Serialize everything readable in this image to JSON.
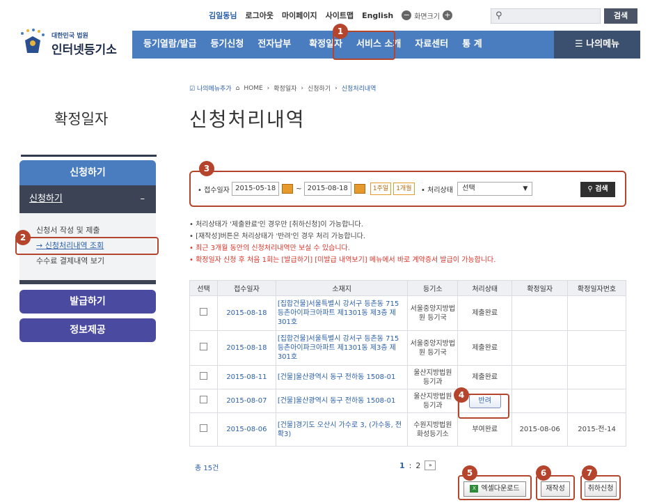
{
  "util": {
    "user": "김일동님",
    "logout": "로그아웃",
    "mypage": "마이페이지",
    "sitemap": "사이트맵",
    "english": "English",
    "screen_size": "화면크기",
    "search_button": "검색"
  },
  "logo": {
    "small": "대한민국 법원",
    "big": "인터넷등기소"
  },
  "nav": {
    "items": [
      "등기열람/발급",
      "등기신청",
      "전자납부",
      "확정일자",
      "서비스 소개",
      "자료센터",
      "통 계"
    ],
    "mymenu": "나의메뉴"
  },
  "breadcrumb": {
    "add": "나의메뉴추가",
    "home": "HOME",
    "path1": "확정일자",
    "path2": "신청하기",
    "current": "신청처리내역"
  },
  "side": {
    "title": "확정일자",
    "head": "신청하기",
    "sub": "신청하기",
    "sub_toggle": "–",
    "links": [
      "신청서 작성 및 제출",
      "신청처리내역 조회",
      "수수료 결제내역 보기"
    ],
    "btn1": "발급하기",
    "btn2": "정보제공"
  },
  "page_title": "신청처리내역",
  "filter": {
    "date_label": "접수일자",
    "date_from": "2015-05-18",
    "date_to": "2015-08-18",
    "tilde": "~",
    "week": "1주일",
    "month": "1개월",
    "status_label": "처리상태",
    "status_value": "선택",
    "search": "검색"
  },
  "notices": [
    "처리상태가 '제출완료'인 경우만 [취하신청]이 가능합니다.",
    "[재작성]버튼은 처리상태가 '반려'인 경우 처리 가능합니다.",
    "최근 3개월 동안의 신청처리내역만 보실 수 있습니다.",
    "확정일자 신청 후 처음 1회는 [발급하기] [미발급 내역보기] 메뉴에서 바로 계약증서 발급이 가능합니다."
  ],
  "table": {
    "headers": [
      "선택",
      "접수일자",
      "소재지",
      "등기소",
      "처리상태",
      "확정일자",
      "확정일자번호"
    ],
    "rows": [
      {
        "date": "2015-08-18",
        "addr": "[집합건물]서울특별시 강서구 등촌동 715 등촌아이파크아파트 제1301동 제3층 제301호",
        "office": "서울중앙지방법원 등기국",
        "status": "제출완료",
        "fixed_date": "",
        "fixed_no": ""
      },
      {
        "date": "2015-08-18",
        "addr": "[집합건물]서울특별시 강서구 등촌동 715 등촌아이파크아파트 제1301동 제3층 제301호",
        "office": "서울중앙지방법원 등기국",
        "status": "제출완료",
        "fixed_date": "",
        "fixed_no": ""
      },
      {
        "date": "2015-08-11",
        "addr": "[건물]울산광역시 동구 전하동 1508-01",
        "office": "울산지방법원 등기과",
        "status": "제출완료",
        "fixed_date": "",
        "fixed_no": ""
      },
      {
        "date": "2015-08-07",
        "addr": "[건물]울산광역시 동구 전하동 1508-01",
        "office": "울산지방법원 등기과",
        "status": "반려",
        "fixed_date": "",
        "fixed_no": ""
      },
      {
        "date": "2015-08-06",
        "addr": "[건물]경기도 오산시 가수로 3, (가수동, 전확3)",
        "office": "수원지방법원 화성등기소",
        "status": "부여완료",
        "fixed_date": "2015-08-06",
        "fixed_no": "2015-전-14"
      }
    ]
  },
  "total": "총 15건",
  "pager": {
    "p1": "1",
    "sep": ":",
    "p2": "2",
    "next": "»"
  },
  "buttons": {
    "excel": "엑셀다운로드",
    "rewrite": "재작성",
    "cancel": "취하신청"
  },
  "badges": [
    "1",
    "2",
    "3",
    "4",
    "5",
    "6",
    "7"
  ],
  "colors": {
    "nav": "#4a7dc0",
    "highlight": "#b5442d",
    "notice_red": "#d9352a"
  }
}
